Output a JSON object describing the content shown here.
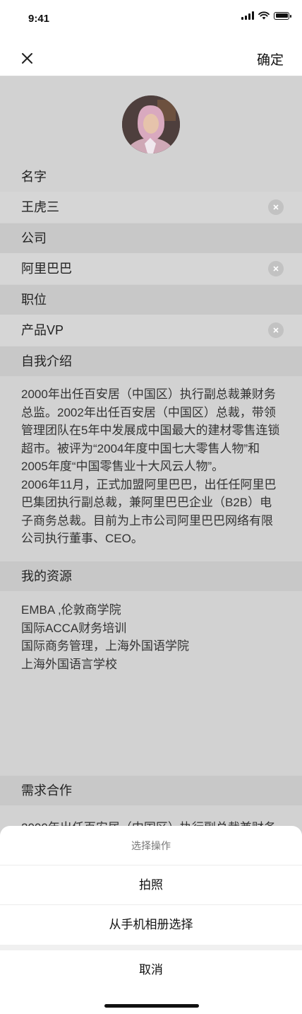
{
  "status_bar": {
    "time": "9:41"
  },
  "nav": {
    "confirm_label": "确定"
  },
  "fields": {
    "name": {
      "label": "名字",
      "value": "王虎三"
    },
    "company": {
      "label": "公司",
      "value": "阿里巴巴"
    },
    "position": {
      "label": "职位",
      "value": "产品VP"
    }
  },
  "intro": {
    "label": "自我介绍",
    "lines": [
      "2000年出任百安居（中国区）执行副总裁兼财务",
      "总监。2002年出任百安居（中国区）总裁，带领",
      "管理团队在5年中发展成中国最大的建材零售连锁",
      "超市。被评为“2004年度中国七大零售人物”和",
      "2005年度“中国零售业十大风云人物”。",
      "2006年11月，正式加盟阿里巴巴，出任任阿里巴",
      "巴集团执行副总裁，兼阿里巴巴企业（B2B）电",
      "子商务总裁。目前为上市公司阿里巴巴网络有限",
      "公司执行董事、CEO。"
    ]
  },
  "resources": {
    "label": "我的资源",
    "lines": [
      "EMBA ,伦敦商学院",
      "国际ACCA财务培训",
      "国际商务管理，上海外国语学院",
      "上海外国语言学校"
    ]
  },
  "cooperation": {
    "label": "需求合作",
    "preview": "2000年出任百安居（中国区）执行副总裁兼财务"
  },
  "action_sheet": {
    "title": "选择操作",
    "options": [
      "拍照",
      "从手机相册选择"
    ],
    "cancel": "取消"
  },
  "icons": {
    "close": "close-icon",
    "clear": "clear-icon",
    "signal": "signal-icon",
    "wifi": "wifi-icon",
    "battery": "battery-icon"
  }
}
